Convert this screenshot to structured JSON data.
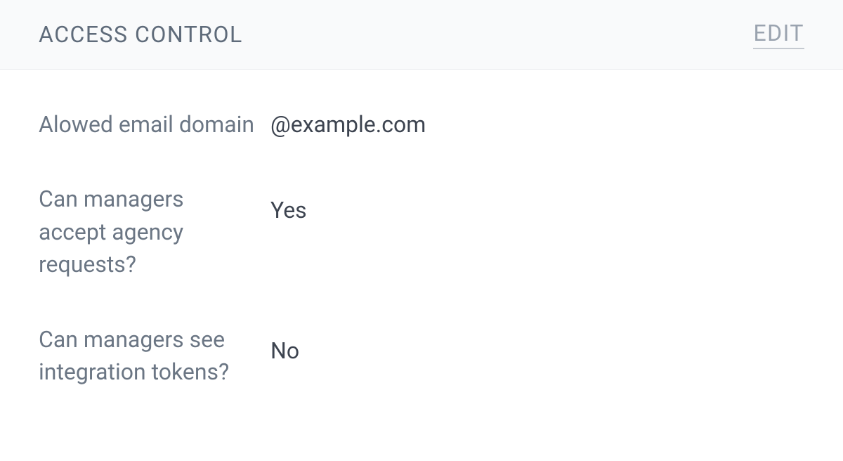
{
  "header": {
    "title": "ACCESS CONTROL",
    "edit_label": "EDIT"
  },
  "settings": {
    "allowed_email_domain": {
      "label": "Alowed email domain",
      "value": "@example.com"
    },
    "managers_accept_agency": {
      "label": "Can managers accept agency requests?",
      "value": "Yes"
    },
    "managers_see_tokens": {
      "label": "Can managers see integration tokens?",
      "value": "No"
    }
  }
}
